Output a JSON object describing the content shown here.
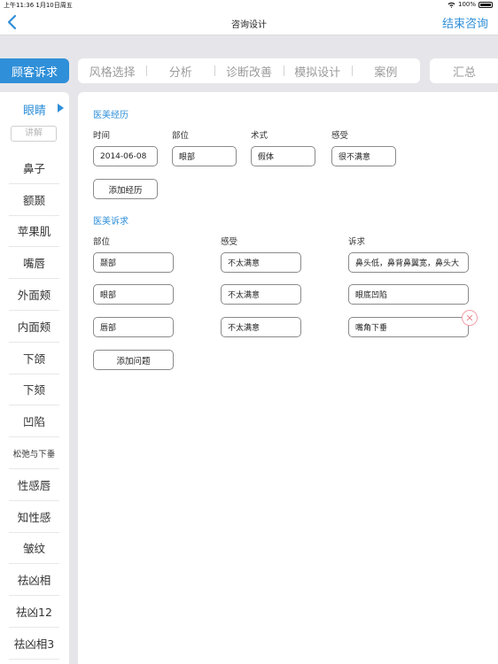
{
  "status_bar": {
    "time_date": "上午11:36  1月10日周五",
    "battery": "100%"
  },
  "nav": {
    "title": "咨询设计",
    "end_label": "结束咨询"
  },
  "tabs": {
    "active": "顾客诉求",
    "group": [
      "风格选择",
      "分析",
      "诊断改善",
      "模拟设计",
      "案例"
    ],
    "summary": "汇总"
  },
  "sidebar": {
    "current": "眼睛",
    "explain": "讲解",
    "items": [
      "鼻子",
      "额颞",
      "苹果肌",
      "嘴唇",
      "外面颊",
      "内面颊",
      "下颌",
      "下颏",
      "凹陷",
      "松弛与下垂",
      "性感唇",
      "知性感",
      "皱纹",
      "祛凶相",
      "祛凶12",
      "祛凶相3"
    ]
  },
  "history": {
    "title": "医美经历",
    "headers": {
      "time": "时间",
      "part": "部位",
      "method": "术式",
      "feeling": "感受"
    },
    "row": {
      "time": "2014-06-08",
      "part": "眼部",
      "method": "假体",
      "feeling": "很不满意"
    },
    "add_label": "添加经历"
  },
  "demands": {
    "title": "医美诉求",
    "headers": {
      "part": "部位",
      "feeling": "感受",
      "demand": "诉求"
    },
    "rows": [
      {
        "part": "颞部",
        "feeling": "不太满意",
        "demand": "鼻头低，鼻背鼻翼宽，鼻头大"
      },
      {
        "part": "眼部",
        "feeling": "不太满意",
        "demand": "眼底凹陷"
      },
      {
        "part": "唇部",
        "feeling": "不太满意",
        "demand": "嘴角下垂"
      }
    ],
    "add_label": "添加问题"
  }
}
